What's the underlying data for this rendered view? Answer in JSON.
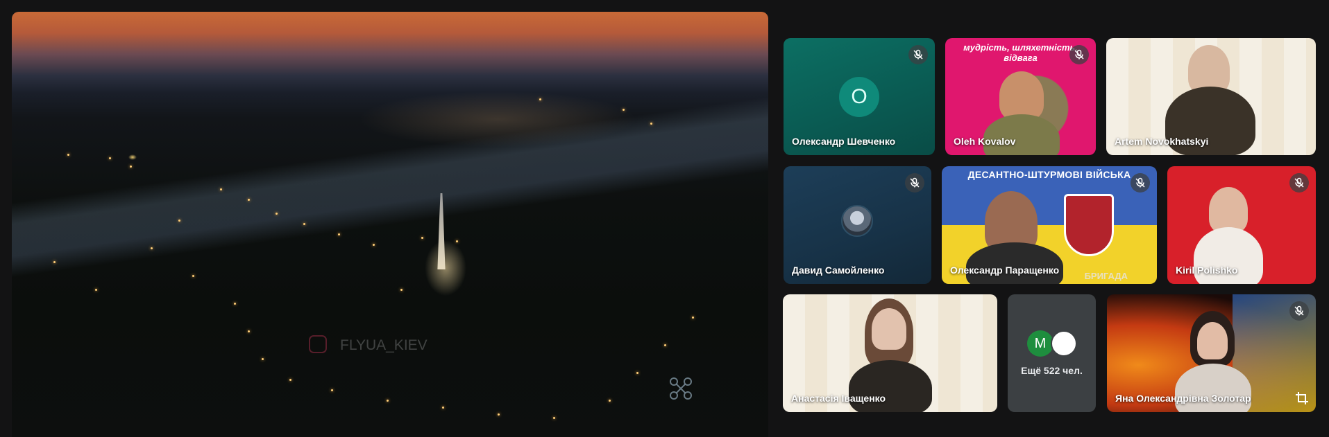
{
  "main_video": {
    "watermark": "FLYUA_KIEV"
  },
  "participants": [
    {
      "name": "Олександр Шевченко",
      "avatar_letter": "О",
      "muted": true
    },
    {
      "name": "Oleh Kovalov",
      "muted": true,
      "banner": "мудрість, шляхетність, відвага"
    },
    {
      "name": "Artem Novokhatskyi",
      "muted": false
    },
    {
      "name": "Давид Самойленко",
      "muted": true
    },
    {
      "name": "Олександр Паращенко",
      "muted": true,
      "banner_top": "ДЕСАНТНО-ШТУРМОВІ ВІЙСЬКА",
      "banner_bottom": "БРИГАДА"
    },
    {
      "name": "Kiril Polishko",
      "muted": true
    },
    {
      "name": "Анастасія Іващенко",
      "muted": false
    },
    {
      "name": "Яна Олександрівна Золотар",
      "muted": true
    }
  ],
  "more_tile": {
    "avatar_letter": "M",
    "label": "Ещё 522 чел."
  },
  "colors": {
    "background": "#131314",
    "mic_bg": "#3c4043",
    "accent_teal": "#0f8a7a"
  }
}
